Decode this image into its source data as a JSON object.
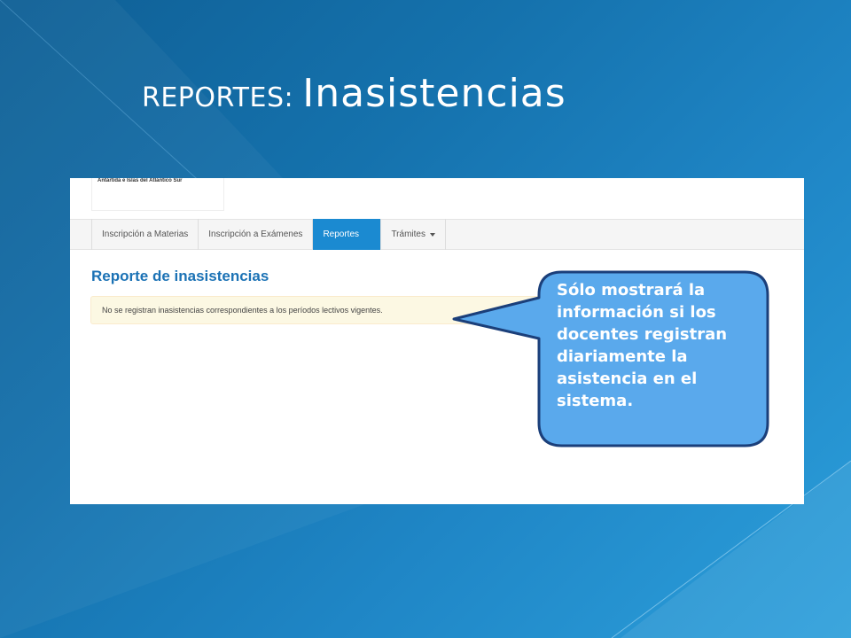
{
  "slide": {
    "title_prefix": "REPORTES:",
    "title_main": "Inasistencias"
  },
  "app": {
    "logo_text": "Antártida e Islas del Atlántico Sur",
    "nav": [
      {
        "label": "Inscripción a Materias",
        "active": false
      },
      {
        "label": "Inscripción a Exámenes",
        "active": false
      },
      {
        "label": "Reportes",
        "active": true
      },
      {
        "label": "Trámites",
        "active": false,
        "has_dropdown": true
      }
    ],
    "page_heading": "Reporte de inasistencias",
    "alert_message": "No se registran inasistencias correspondientes a los períodos lectivos vigentes."
  },
  "callout": {
    "text": "Sólo mostrará la información si los docentes registran diariamente la asistencia en el sistema."
  },
  "colors": {
    "slide_background": "#1572ad",
    "nav_active": "#1b8ad1",
    "heading": "#1b72b5",
    "alert_background": "#fcf8e3",
    "callout_fill": "#5aa9ec",
    "callout_border": "#1b3f7a"
  }
}
